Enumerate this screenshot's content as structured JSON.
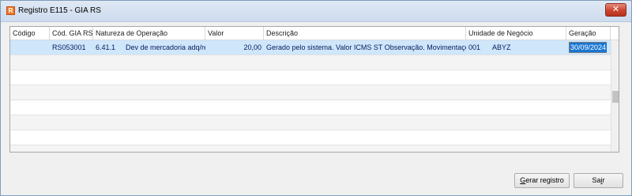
{
  "window": {
    "title": "Registro E115 - GIA RS",
    "close_symbol": "✕"
  },
  "table": {
    "columns": [
      "Código",
      "Cód. GIA RS",
      "Natureza de Operação",
      "Valor",
      "Descrição",
      "Unidade de Negócio",
      "Geração"
    ],
    "rows": [
      {
        "codigo": "",
        "cod_gia_rs": "RS053001",
        "natureza_codigo": "6.41.1",
        "natureza_descricao": "Dev de mercadoria adq/rec",
        "valor": "20,00",
        "descricao": "Gerado pelo sistema. Valor ICMS ST Observação. Movimentações de",
        "unidade_codigo": "001",
        "unidade_nome": "ABYZ",
        "geracao": "30/09/2024"
      }
    ]
  },
  "buttons": {
    "gerar_prefix": "G",
    "gerar_rest": "erar registro",
    "sair_prefix": "Sa",
    "sair_underline": "i",
    "sair_rest": "r"
  },
  "colors": {
    "selected_row": "#cfe6fb",
    "selection_highlight": "#1976d2",
    "close_button": "#c9432f"
  },
  "icons": {
    "app": "app-icon",
    "close": "close-icon"
  }
}
